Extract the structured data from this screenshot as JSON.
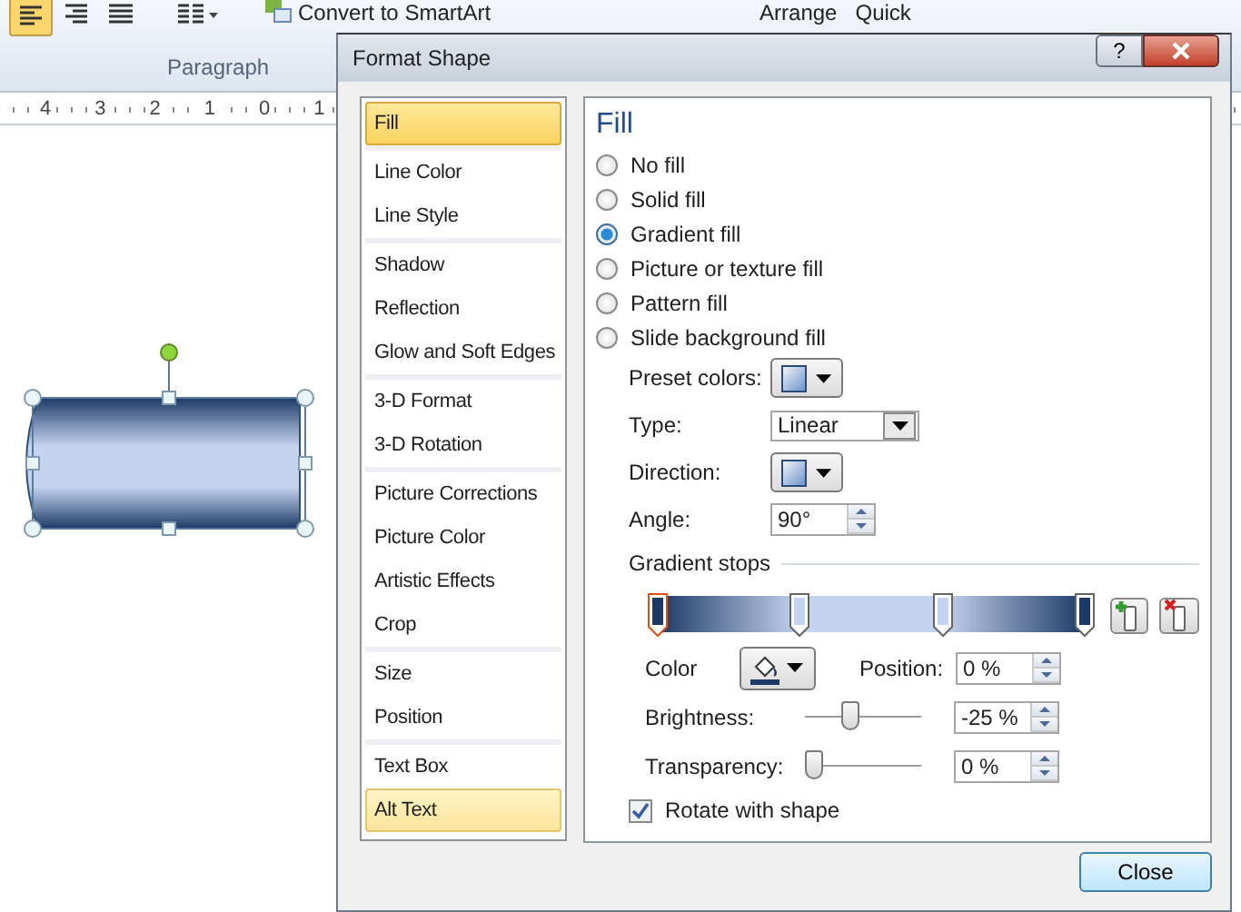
{
  "ribbon": {
    "convert_label": "Convert to SmartArt",
    "group_label": "Paragraph",
    "arrange_label": "Arrange",
    "quick_label": "Quick"
  },
  "ruler": {
    "labels": [
      "4",
      "3",
      "2",
      "1",
      "0",
      "1"
    ]
  },
  "dialog": {
    "title": "Format Shape",
    "help": "?"
  },
  "nav": {
    "groups": [
      [
        {
          "label": "Fill",
          "selected": true,
          "hovered": false
        }
      ],
      [
        {
          "label": "Line Color",
          "selected": false,
          "hovered": false
        },
        {
          "label": "Line Style",
          "selected": false,
          "hovered": false
        }
      ],
      [
        {
          "label": "Shadow",
          "selected": false,
          "hovered": false
        },
        {
          "label": "Reflection",
          "selected": false,
          "hovered": false
        },
        {
          "label": "Glow and Soft Edges",
          "selected": false,
          "hovered": false
        }
      ],
      [
        {
          "label": "3-D Format",
          "selected": false,
          "hovered": false
        },
        {
          "label": "3-D Rotation",
          "selected": false,
          "hovered": false
        }
      ],
      [
        {
          "label": "Picture Corrections",
          "selected": false,
          "hovered": false
        },
        {
          "label": "Picture Color",
          "selected": false,
          "hovered": false
        },
        {
          "label": "Artistic Effects",
          "selected": false,
          "hovered": false
        },
        {
          "label": "Crop",
          "selected": false,
          "hovered": false
        }
      ],
      [
        {
          "label": "Size",
          "selected": false,
          "hovered": false
        },
        {
          "label": "Position",
          "selected": false,
          "hovered": false
        }
      ],
      [
        {
          "label": "Text Box",
          "selected": false,
          "hovered": false
        },
        {
          "label": "Alt Text",
          "selected": false,
          "hovered": true
        }
      ]
    ]
  },
  "panel": {
    "heading": "Fill",
    "fill_options": [
      {
        "label": "No fill",
        "selected": false
      },
      {
        "label": "Solid fill",
        "selected": false
      },
      {
        "label": "Gradient fill",
        "selected": true
      },
      {
        "label": "Picture or texture fill",
        "selected": false
      },
      {
        "label": "Pattern fill",
        "selected": false
      },
      {
        "label": "Slide background fill",
        "selected": false
      }
    ],
    "preset_colors": {
      "label": "Preset colors:"
    },
    "type": {
      "label": "Type:",
      "value": "Linear"
    },
    "direction": {
      "label": "Direction:"
    },
    "angle": {
      "label": "Angle:",
      "value": "90°"
    },
    "gradient_stops": {
      "label": "Gradient stops",
      "stops": [
        {
          "color": "#1c3a66",
          "selected": true
        },
        {
          "color": "#c5d4ee",
          "selected": false
        },
        {
          "color": "#c5d4ee",
          "selected": false
        },
        {
          "color": "#1c3a66",
          "selected": false
        }
      ]
    },
    "color": {
      "label": "Color"
    },
    "position": {
      "label": "Position:",
      "value": "0 %"
    },
    "brightness": {
      "label": "Brightness:",
      "value": "-25 %",
      "level": 0.37
    },
    "transparency": {
      "label": "Transparency:",
      "value": "0 %",
      "level": 0
    },
    "rotate_with_shape": {
      "label": "Rotate with shape",
      "checked": true
    }
  },
  "close_button": "Close"
}
